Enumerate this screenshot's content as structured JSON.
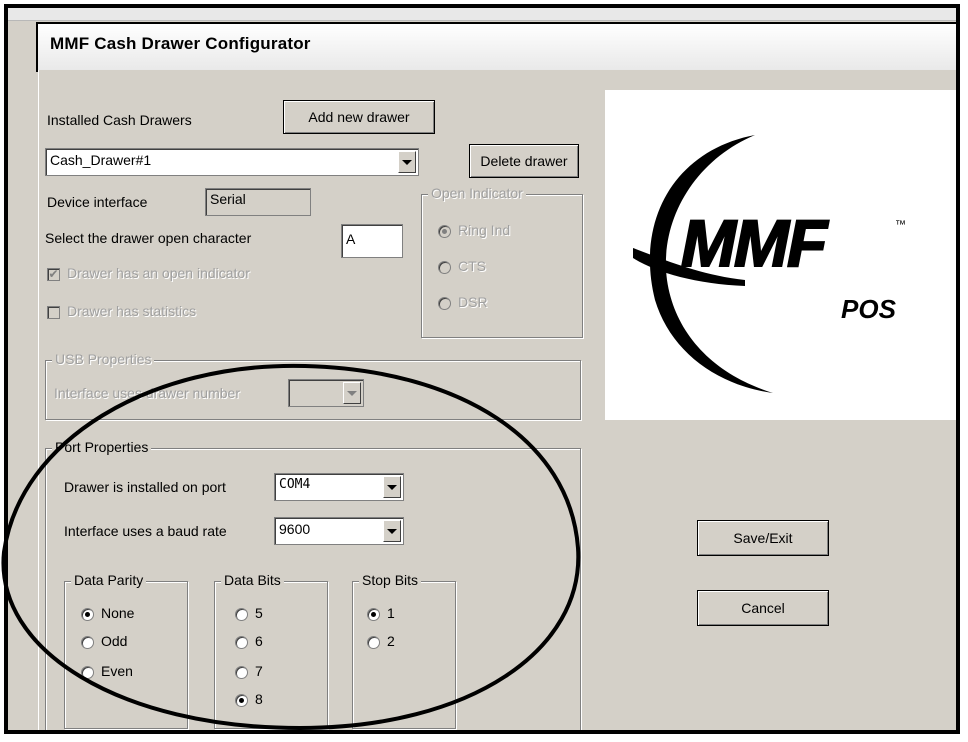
{
  "window": {
    "title": "MMF Cash Drawer Configurator"
  },
  "installed": {
    "label": "Installed Cash Drawers",
    "add_button": "Add new drawer",
    "selected": "Cash_Drawer#1",
    "delete_button": "Delete drawer"
  },
  "device": {
    "interface_label": "Device interface",
    "interface_value": "Serial",
    "open_char_label": "Select the drawer open character",
    "open_char_value": "A",
    "open_indicator_check": "Drawer has an open indicator",
    "open_indicator_checked": true,
    "statistics_check": "Drawer has statistics",
    "statistics_checked": false
  },
  "open_indicator": {
    "legend": "Open Indicator",
    "options": [
      "Ring Ind",
      "CTS",
      "DSR"
    ],
    "selected": "Ring Ind"
  },
  "usb": {
    "legend": "USB Properties",
    "drawer_number_label": "Interface uses drawer number",
    "drawer_number_value": ""
  },
  "port": {
    "legend": "Port Properties",
    "port_label": "Drawer is installed on port",
    "port_value": "COM4",
    "baud_label": "Interface uses a baud rate",
    "baud_value": "9600",
    "parity": {
      "legend": "Data Parity",
      "options": [
        "None",
        "Odd",
        "Even"
      ],
      "selected": "None"
    },
    "data_bits": {
      "legend": "Data Bits",
      "options": [
        "5",
        "6",
        "7",
        "8"
      ],
      "selected": "8"
    },
    "stop_bits": {
      "legend": "Stop Bits",
      "options": [
        "1",
        "2"
      ],
      "selected": "1"
    }
  },
  "actions": {
    "save": "Save/Exit",
    "cancel": "Cancel"
  },
  "logo": {
    "brand": "MMF",
    "trademark": "™",
    "sub": "POS"
  },
  "colors": {
    "dialog_bg": "#d4d0c8",
    "disabled_text": "#a0a0a0"
  }
}
